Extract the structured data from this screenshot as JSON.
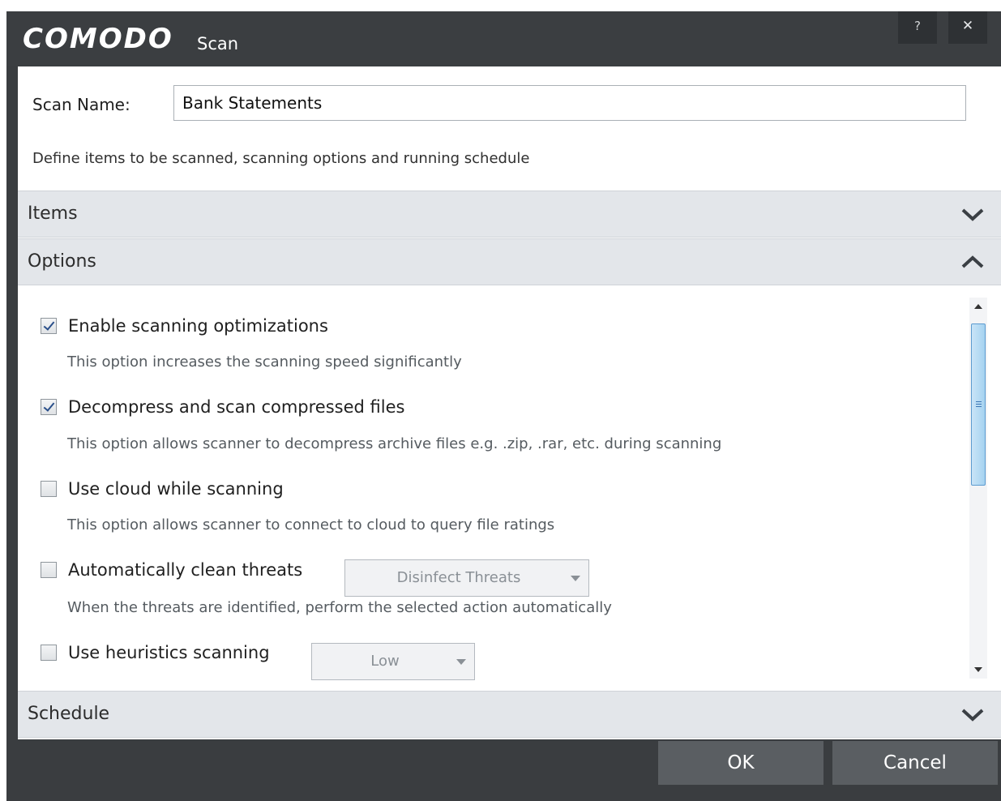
{
  "window": {
    "brand": "COMODO",
    "subtitle": "Scan",
    "help_label": "?",
    "close_label": "✕"
  },
  "scan_name": {
    "label": "Scan Name:",
    "value": "Bank Statements"
  },
  "description": "Define items to be scanned, scanning options and running schedule",
  "sections": {
    "items": {
      "label": "Items",
      "expanded": false
    },
    "options": {
      "label": "Options",
      "expanded": true
    },
    "schedule": {
      "label": "Schedule",
      "expanded": false
    }
  },
  "options": [
    {
      "label": "Enable scanning optimizations",
      "checked": true,
      "help": "This option increases the scanning speed significantly"
    },
    {
      "label": "Decompress and scan compressed files",
      "checked": true,
      "help": "This option allows scanner to decompress archive files e.g. .zip, .rar, etc. during scanning"
    },
    {
      "label": "Use cloud while scanning",
      "checked": false,
      "help": "This option allows scanner to connect to cloud to query file ratings"
    },
    {
      "label": "Automatically clean threats",
      "checked": false,
      "dropdown": "Disinfect Threats",
      "help": "When the threats are identified, perform the selected action automatically"
    },
    {
      "label": "Use heuristics scanning",
      "checked": false,
      "dropdown": "Low"
    }
  ],
  "footer": {
    "ok_label": "OK",
    "cancel_label": "Cancel"
  },
  "colors": {
    "titlebar": "#3b3e41",
    "section_header": "#e3e6ea",
    "footer_button": "#5a5e62"
  }
}
